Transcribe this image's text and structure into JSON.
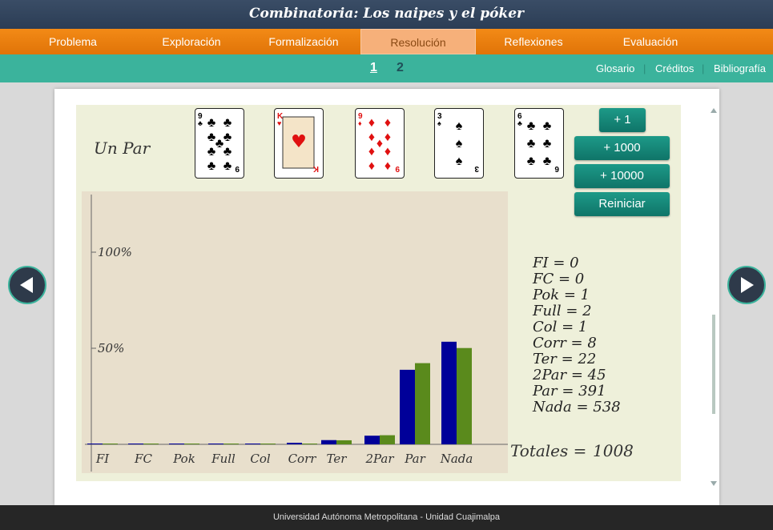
{
  "app": {
    "title": "Combinatoria: Los naipes y el póker"
  },
  "nav": {
    "items": [
      "Problema",
      "Exploración",
      "Formalización",
      "Resolución",
      "Reflexiones",
      "Evaluación"
    ],
    "active_index": 3
  },
  "subnav": {
    "pages": [
      "1",
      "2"
    ],
    "current_page": "1",
    "links": [
      "Glosario",
      "Créditos",
      "Bibliografía"
    ]
  },
  "hand": {
    "label": "Un Par",
    "cards": [
      {
        "rank": "9",
        "suit": "clubs",
        "color": "#000000"
      },
      {
        "rank": "K",
        "suit": "hearts",
        "color": "#e01010"
      },
      {
        "rank": "9",
        "suit": "diamonds",
        "color": "#e01010"
      },
      {
        "rank": "3",
        "suit": "spades",
        "color": "#000000"
      },
      {
        "rank": "6",
        "suit": "clubs",
        "color": "#000000"
      }
    ]
  },
  "buttons": {
    "plus1": "+ 1",
    "plus1000": "+ 1000",
    "plus10000": "+ 10000",
    "reset": "Reiniciar"
  },
  "chart_data": {
    "type": "bar",
    "categories": [
      "FI",
      "FC",
      "Pok",
      "Full",
      "Col",
      "Corr",
      "Ter",
      "2Par",
      "Par",
      "Nada"
    ],
    "series": [
      {
        "values": [
          0.0,
          0.0,
          0.1,
          0.2,
          0.1,
          0.8,
          2.2,
          4.5,
          38.8,
          53.4
        ],
        "color": "#000099"
      },
      {
        "values": [
          0.0,
          0.0,
          0.02,
          0.14,
          0.2,
          0.39,
          2.11,
          4.75,
          42.26,
          50.12
        ],
        "color": "#5a8a1c"
      }
    ],
    "ytick_labels": [
      "100%",
      "50%"
    ],
    "ylim": [
      0,
      130
    ]
  },
  "stats": [
    {
      "label": "FI",
      "value": "0"
    },
    {
      "label": "FC",
      "value": "0"
    },
    {
      "label": "Pok",
      "value": "1"
    },
    {
      "label": "Full",
      "value": "2"
    },
    {
      "label": "Col",
      "value": "1"
    },
    {
      "label": "Corr",
      "value": "8"
    },
    {
      "label": "Ter",
      "value": "22"
    },
    {
      "label": "2Par",
      "value": "45"
    },
    {
      "label": "Par",
      "value": "391"
    },
    {
      "label": "Nada",
      "value": "538"
    }
  ],
  "totals": {
    "label": "Totales =",
    "value": "1008"
  },
  "footer": {
    "text": "Universidad Autónoma Metropolitana - Unidad Cuajimalpa"
  },
  "colors": {
    "nav_orange": "#f08010",
    "teal": "#3bb39c",
    "button_teal": "#13806f",
    "title_bar": "#34475f"
  }
}
